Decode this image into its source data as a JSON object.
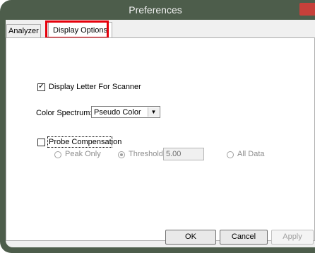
{
  "window": {
    "title": "Preferences"
  },
  "tabs": [
    {
      "label": "Analyzer"
    },
    {
      "label": "Display Options"
    }
  ],
  "display_options": {
    "display_letter_label": "Display Letter For Scanner",
    "display_letter_checked": true,
    "color_spectrum_label": "Color Spectrum:",
    "color_spectrum_value": "Pseudo Color",
    "probe_compensation_label": "Probe Compensation",
    "probe_compensation_checked": false,
    "radio_peak_only": "Peak Only",
    "radio_threshold": "Threshold",
    "threshold_value": "5.00",
    "radio_all_data": "All Data"
  },
  "buttons": {
    "ok": "OK",
    "cancel": "Cancel",
    "apply": "Apply"
  },
  "colors": {
    "frame": "#4d5d4b",
    "close": "#c7403a",
    "highlight": "#e6000b"
  }
}
